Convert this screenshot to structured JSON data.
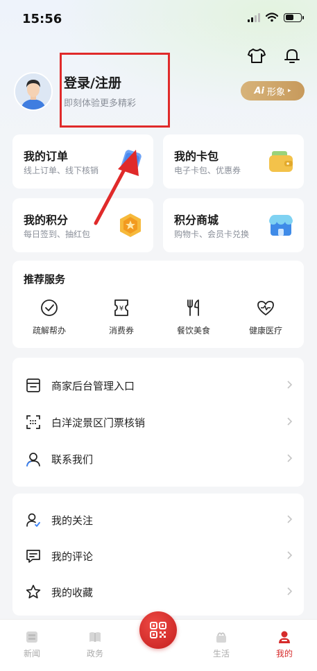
{
  "status": {
    "time": "15:56"
  },
  "header": {
    "icons": [
      "tshirt-icon",
      "bell-icon"
    ]
  },
  "profile": {
    "title": "登录/注册",
    "subtitle": "即刻体验更多精彩",
    "ai_badge": {
      "ai": "Ai",
      "label": "形象"
    }
  },
  "cards": [
    {
      "title": "我的订单",
      "subtitle": "线上订单、线下核销"
    },
    {
      "title": "我的卡包",
      "subtitle": "电子卡包、优惠券"
    },
    {
      "title": "我的积分",
      "subtitle": "每日签到、抽红包"
    },
    {
      "title": "积分商城",
      "subtitle": "购物卡、会员卡兑换"
    }
  ],
  "services": {
    "title": "推荐服务",
    "items": [
      {
        "label": "疏解帮办",
        "icon": "check-circle-icon"
      },
      {
        "label": "消费券",
        "icon": "coupon-icon"
      },
      {
        "label": "餐饮美食",
        "icon": "cutlery-icon"
      },
      {
        "label": "健康医疗",
        "icon": "heart-pulse-icon"
      }
    ]
  },
  "list1": [
    {
      "label": "商家后台管理入口",
      "icon": "store-icon"
    },
    {
      "label": "白洋淀景区门票核销",
      "icon": "scan-icon"
    },
    {
      "label": "联系我们",
      "icon": "contact-icon"
    }
  ],
  "list2": [
    {
      "label": "我的关注",
      "icon": "follow-icon"
    },
    {
      "label": "我的评论",
      "icon": "comment-icon"
    },
    {
      "label": "我的收藏",
      "icon": "star-icon"
    }
  ],
  "nav": [
    {
      "label": "新闻"
    },
    {
      "label": "政务"
    },
    {
      "label": "生活"
    },
    {
      "label": "我的"
    }
  ],
  "colors": {
    "accent": "#d62b2b",
    "highlight": "#e02a2a",
    "gold": "#c79a5c"
  }
}
